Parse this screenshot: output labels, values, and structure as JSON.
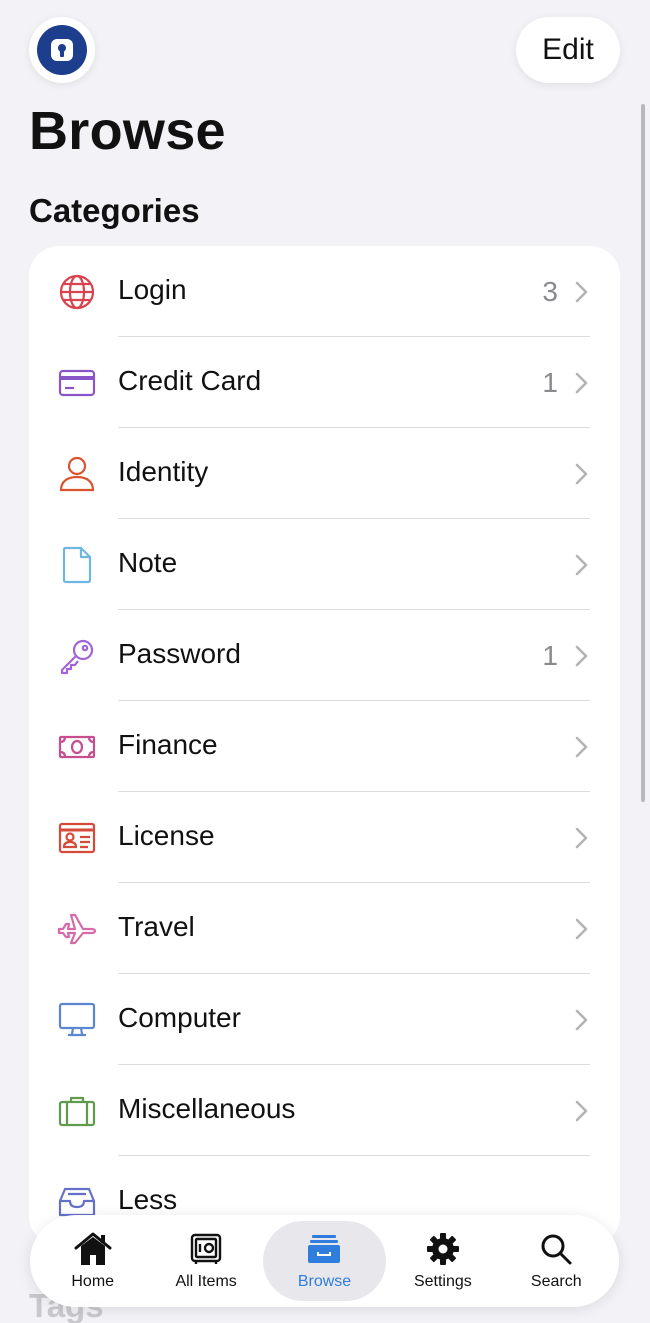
{
  "header": {
    "edit_label": "Edit",
    "title": "Browse",
    "section_title": "Categories"
  },
  "categories": [
    {
      "label": "Login",
      "count": "3",
      "icon": "globe-icon",
      "color": "#d8434f"
    },
    {
      "label": "Credit Card",
      "count": "1",
      "icon": "credit-card-icon",
      "color": "#8a55c9"
    },
    {
      "label": "Identity",
      "count": "",
      "icon": "person-icon",
      "color": "#d9532f"
    },
    {
      "label": "Note",
      "count": "",
      "icon": "note-icon",
      "color": "#6fb7e3"
    },
    {
      "label": "Password",
      "count": "1",
      "icon": "key-icon",
      "color": "#a065d8"
    },
    {
      "label": "Finance",
      "count": "",
      "icon": "money-icon",
      "color": "#c54f8f"
    },
    {
      "label": "License",
      "count": "",
      "icon": "license-icon",
      "color": "#d64a3a"
    },
    {
      "label": "Travel",
      "count": "",
      "icon": "airplane-icon",
      "color": "#d66aa8"
    },
    {
      "label": "Computer",
      "count": "",
      "icon": "computer-icon",
      "color": "#5d86d1"
    },
    {
      "label": "Miscellaneous",
      "count": "",
      "icon": "briefcase-icon",
      "color": "#5f9a4d"
    },
    {
      "label": "Less",
      "count": "",
      "icon": "tray-icon",
      "color": "#6470c8"
    }
  ],
  "tags_peek": "Tags",
  "tab_bar": {
    "tabs": [
      {
        "label": "Home",
        "icon": "house-icon",
        "active": false
      },
      {
        "label": "All Items",
        "icon": "vault-icon",
        "active": false
      },
      {
        "label": "Browse",
        "icon": "folder-icon",
        "active": true
      },
      {
        "label": "Settings",
        "icon": "gear-icon",
        "active": false
      },
      {
        "label": "Search",
        "icon": "search-icon",
        "active": false
      }
    ],
    "active_color": "#2f7ddc"
  },
  "colors": {
    "background": "#f2f2f7",
    "logo": "#1c3e8c"
  }
}
